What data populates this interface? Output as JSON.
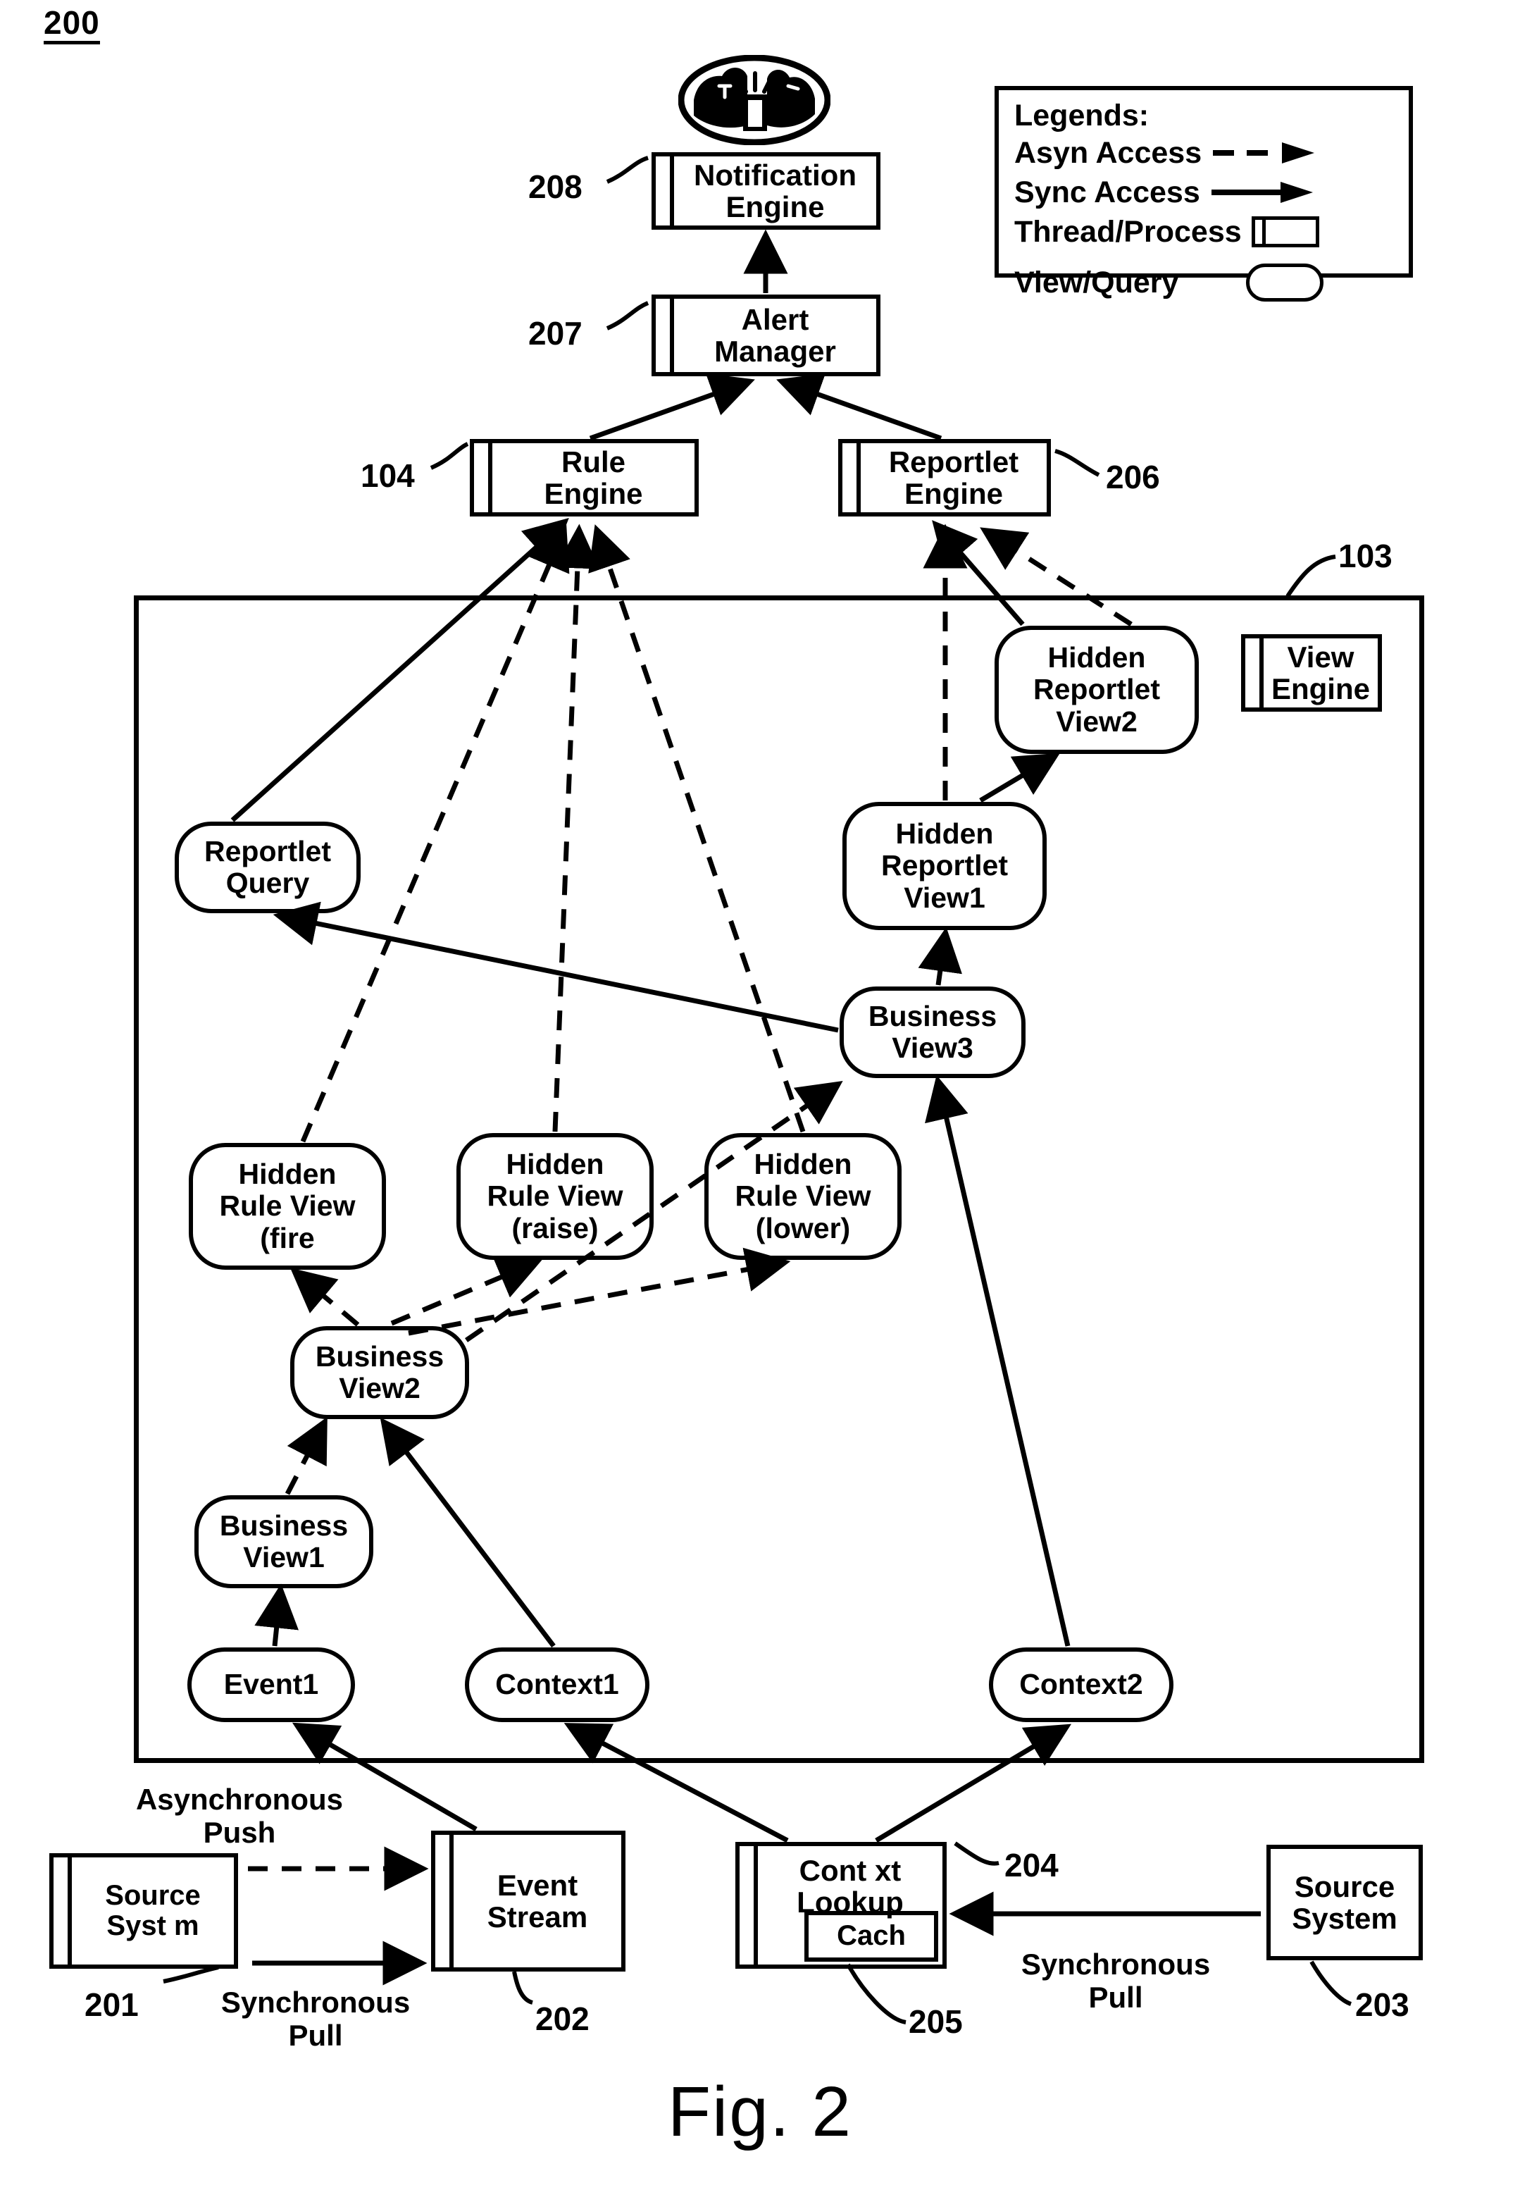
{
  "figure": {
    "ref_number": "200",
    "caption": "Fig. 2"
  },
  "legend": {
    "title": "Legends:",
    "rows": [
      {
        "label": "Asyn Access",
        "art": "dashed-arrow-icon"
      },
      {
        "label": "Sync Access",
        "art": "solid-arrow-icon"
      },
      {
        "label": "Thread/Process",
        "art": "thread-process-shape-icon"
      },
      {
        "label": "View/Query",
        "art": "view-query-shape-icon"
      }
    ]
  },
  "nodes": {
    "notification_engine": {
      "label": "Notification\nEngine",
      "ref": "208"
    },
    "alert_manager": {
      "label": "Alert\nManager",
      "ref": "207"
    },
    "rule_engine": {
      "label": "Rule\nEngine",
      "ref": "104"
    },
    "reportlet_engine": {
      "label": "Reportlet\nEngine",
      "ref": "206"
    },
    "view_engine": {
      "label": "View\nEngine"
    },
    "container": {
      "ref": "103"
    },
    "hidden_reportlet_view2": {
      "label": "Hidden\nReportlet\nView2"
    },
    "hidden_reportlet_view1": {
      "label": "Hidden\nReportlet\nView1"
    },
    "reportlet_query": {
      "label": "Reportlet\nQuery"
    },
    "business_view3": {
      "label": "Business\nView3"
    },
    "hidden_rule_view_fire": {
      "label": "Hidden\nRule View\n(fire"
    },
    "hidden_rule_view_raise": {
      "label": "Hidden\nRule View\n(raise)"
    },
    "hidden_rule_view_lower": {
      "label": "Hidden\nRule View\n(lower)"
    },
    "business_view2": {
      "label": "Business\nView2"
    },
    "business_view1": {
      "label": "Business\nView1"
    },
    "event1": {
      "label": "Event1"
    },
    "context1": {
      "label": "Context1"
    },
    "context2": {
      "label": "Context2"
    },
    "source_system_left": {
      "label": "Source\nSyst m",
      "ref": "201"
    },
    "event_stream": {
      "label": "Event\nStream",
      "ref": "202"
    },
    "context_lookup": {
      "label": "Cont  xt\nLookup",
      "ref": "204"
    },
    "cache": {
      "label": "Cach",
      "ref": "205"
    },
    "source_system_right": {
      "label": "Source\nSystem",
      "ref": "203"
    }
  },
  "annotations": {
    "async_push": "Asynchronous\nPush",
    "sync_pull_left": "Synchronous\nPull",
    "sync_pull_right": "Synchronous\nPull"
  },
  "colors": {
    "ink": "#000000",
    "paper": "#ffffff"
  }
}
